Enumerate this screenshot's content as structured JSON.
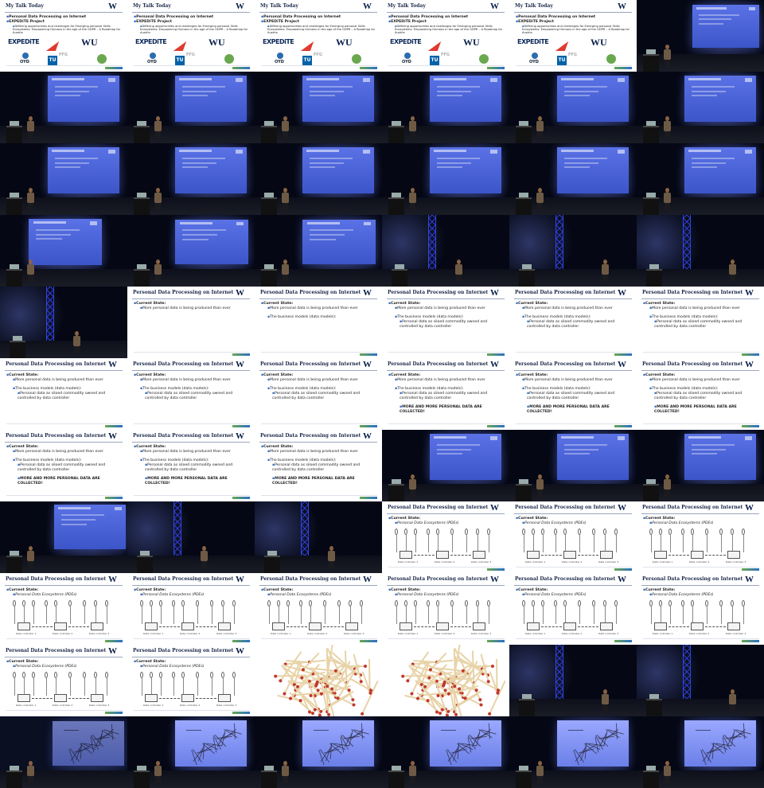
{
  "slides": {
    "talk": {
      "title": "My Talk Today",
      "bullets": [
        "Personal Data Processing on Internet",
        "EXPEDiTE Project",
        "Differing opportunities and challenges for Emerging personal Skills Ecosystems: Empowering Humans in the age of the GDPR – A Roadmap for Austria"
      ],
      "logos": [
        "EXPEDiTE",
        "OYD",
        "FFG",
        "TU",
        "WU"
      ]
    },
    "processing": {
      "title": "Personal Data Processing on Internet",
      "current_state": "Current State:",
      "more_data": "More personal data is being produced than ever",
      "business_models": "The business models (data models):",
      "siloed": "Personal data as siloed commodity owned and controlled by data controller",
      "collected": "MORE AND MORE PERSONAL DATA ARE COLLECTED!",
      "pdes": "Personal Data Ecosystems (PDEs)",
      "data_controller_1": "Data controller 1",
      "data_controller_2": "Data controller 2",
      "data_controller_3": "Data controller 3"
    },
    "logo_mark": "W"
  },
  "colors": {
    "slide_title": "#1b2a4a",
    "bullet_accent": "#2a6fc9",
    "projector_blue": "#4a64dc",
    "background": "#000000",
    "match_head": "#c0392b"
  }
}
